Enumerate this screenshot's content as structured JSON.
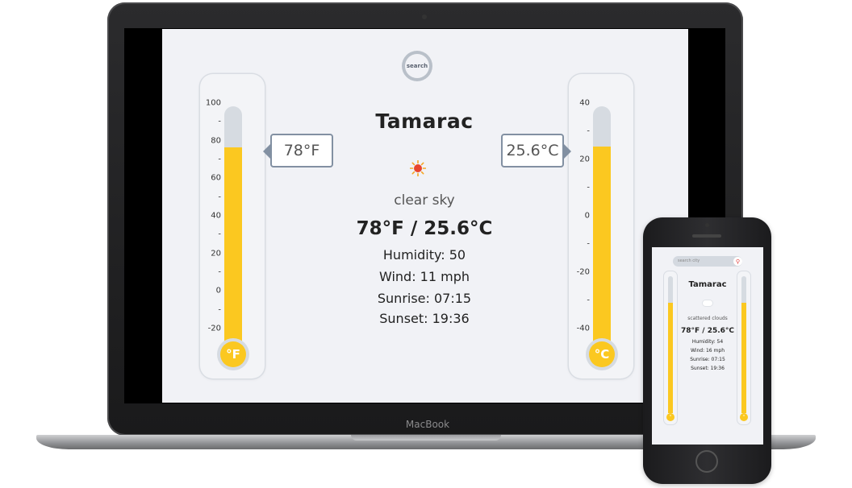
{
  "laptop": {
    "brand": "MacBook",
    "search_label": "search",
    "city": "Tamarac",
    "description": "clear sky",
    "temps": "78°F / 25.6°C",
    "humidity": "Humidity: 50",
    "wind": "Wind: 11 mph",
    "sunrise": "Sunrise: 07:15",
    "sunset": "Sunset: 19:36",
    "fahrenheit": {
      "reading": "78°F",
      "unit_symbol": "°F",
      "ticks": [
        "100",
        "-",
        "80",
        "-",
        "60",
        "-",
        "40",
        "-",
        "20",
        "-",
        "0",
        "-",
        "-20"
      ],
      "min": -20,
      "max": 100,
      "value": 78
    },
    "celsius": {
      "reading": "25.6°C",
      "unit_symbol": "°C",
      "ticks": [
        "40",
        "-",
        "20",
        "-",
        "0",
        "-",
        "-20",
        "-",
        "-40"
      ],
      "min": -40,
      "max": 40,
      "value": 25.6
    },
    "icon": "sun-icon"
  },
  "phone": {
    "search_placeholder": "search city",
    "search_icon": "search-icon",
    "city": "Tamarac",
    "description": "scattered clouds",
    "temps": "78°F / 25.6°C",
    "humidity": "Humidity: 54",
    "wind": "Wind: 16 mph",
    "sunrise": "Sunrise: 07:15",
    "sunset": "Sunset: 19:36",
    "icon": "cloud-icon",
    "fahrenheit_value": 78,
    "celsius_value": 25.6
  },
  "colors": {
    "mercury": "#fbc820",
    "tube": "#d6dbe1",
    "background": "#f1f2f6",
    "callout_border": "#8290a2"
  }
}
